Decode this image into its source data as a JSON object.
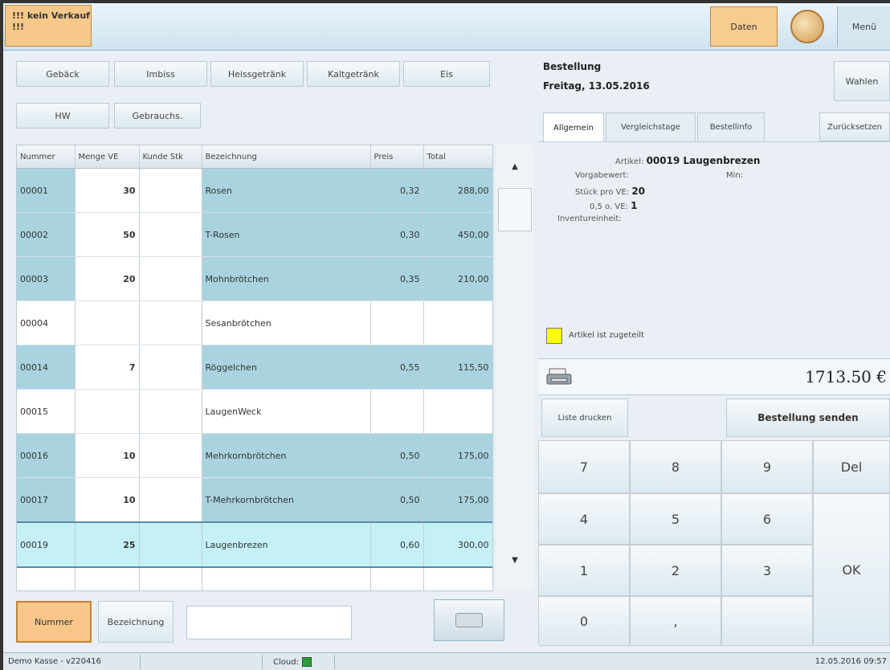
{
  "topbar": {
    "kein_verkauf": "!!! kein Verkauf !!!",
    "daten_label": "Daten",
    "menu_label": "Menü"
  },
  "categories": [
    "Gebäck",
    "Imbiss",
    "Heissgetränk",
    "Kaltgetränk",
    "Eis",
    "HW",
    "Gebrauchs."
  ],
  "table": {
    "columns": [
      "Nummer",
      "Menge VE",
      "Kunde Stk",
      "Bezeichnung",
      "Preis",
      "Total"
    ],
    "rows": [
      {
        "nummer": "00001",
        "menge": "30",
        "kunde": "",
        "bez": "Rosen",
        "preis": "0,32",
        "total": "288,00",
        "state": "filled"
      },
      {
        "nummer": "00002",
        "menge": "50",
        "kunde": "",
        "bez": "T-Rosen",
        "preis": "0,30",
        "total": "450,00",
        "state": "filled"
      },
      {
        "nummer": "00003",
        "menge": "20",
        "kunde": "",
        "bez": "Mohnbrötchen",
        "preis": "0,35",
        "total": "210,00",
        "state": "filled"
      },
      {
        "nummer": "00004",
        "menge": "",
        "kunde": "",
        "bez": "Sesanbrötchen",
        "preis": "",
        "total": "",
        "state": "blank"
      },
      {
        "nummer": "00014",
        "menge": "7",
        "kunde": "",
        "bez": "Röggelchen",
        "preis": "0,55",
        "total": "115,50",
        "state": "filled"
      },
      {
        "nummer": "00015",
        "menge": "",
        "kunde": "",
        "bez": "LaugenWeck",
        "preis": "",
        "total": "",
        "state": "blank"
      },
      {
        "nummer": "00016",
        "menge": "10",
        "kunde": "",
        "bez": "Mehrkornbrötchen",
        "preis": "0,50",
        "total": "175,00",
        "state": "filled"
      },
      {
        "nummer": "00017",
        "menge": "10",
        "kunde": "",
        "bez": "T-Mehrkornbrötchen",
        "preis": "0,50",
        "total": "175,00",
        "state": "filled"
      },
      {
        "nummer": "00019",
        "menge": "25",
        "kunde": "",
        "bez": "Laugenbrezen",
        "preis": "0,60",
        "total": "300,00",
        "state": "sel"
      },
      {
        "nummer": "",
        "menge": "",
        "kunde": "",
        "bez": "",
        "preis": "",
        "total": "",
        "state": "blank"
      }
    ]
  },
  "search": {
    "nummer_label": "Nummer",
    "bezeichnung_label": "Bezeichnung",
    "value": ""
  },
  "order": {
    "title": "Bestellung",
    "date": "Freitag, 13.05.2016",
    "wahlen_label": "Wahlen",
    "zuruck_label": "Zurücksetzen",
    "tabs": [
      "Allgemein",
      "Vergleichstage",
      "Bestellinfo"
    ],
    "artikel_label": "Artikel:",
    "artikel_value": "00019 Laugenbrezen",
    "vorgabewert_label": "Vorgabewert:",
    "min_label": "Min:",
    "stueck_label": "Stück pro VE:",
    "stueck_value": "20",
    "oso_label": "0,5 o. VE:",
    "oso_value": "1",
    "inventur_label": "Inventureinheit:",
    "zugeteilt_label": "Artikel ist zugeteilt",
    "total": "1713.50 €",
    "liste_label": "Liste drucken",
    "senden_label": "Bestellung senden"
  },
  "keypad": {
    "k7": "7",
    "k8": "8",
    "k9": "9",
    "del": "Del",
    "k4": "4",
    "k5": "5",
    "k6": "6",
    "k1": "1",
    "k2": "2",
    "k3": "3",
    "ok": "OK",
    "k0": "0",
    "dot": ","
  },
  "status": {
    "app": "Demo Kasse - v220416",
    "cloud": "Cloud:",
    "datetime": "12.05.2016 09:57"
  }
}
